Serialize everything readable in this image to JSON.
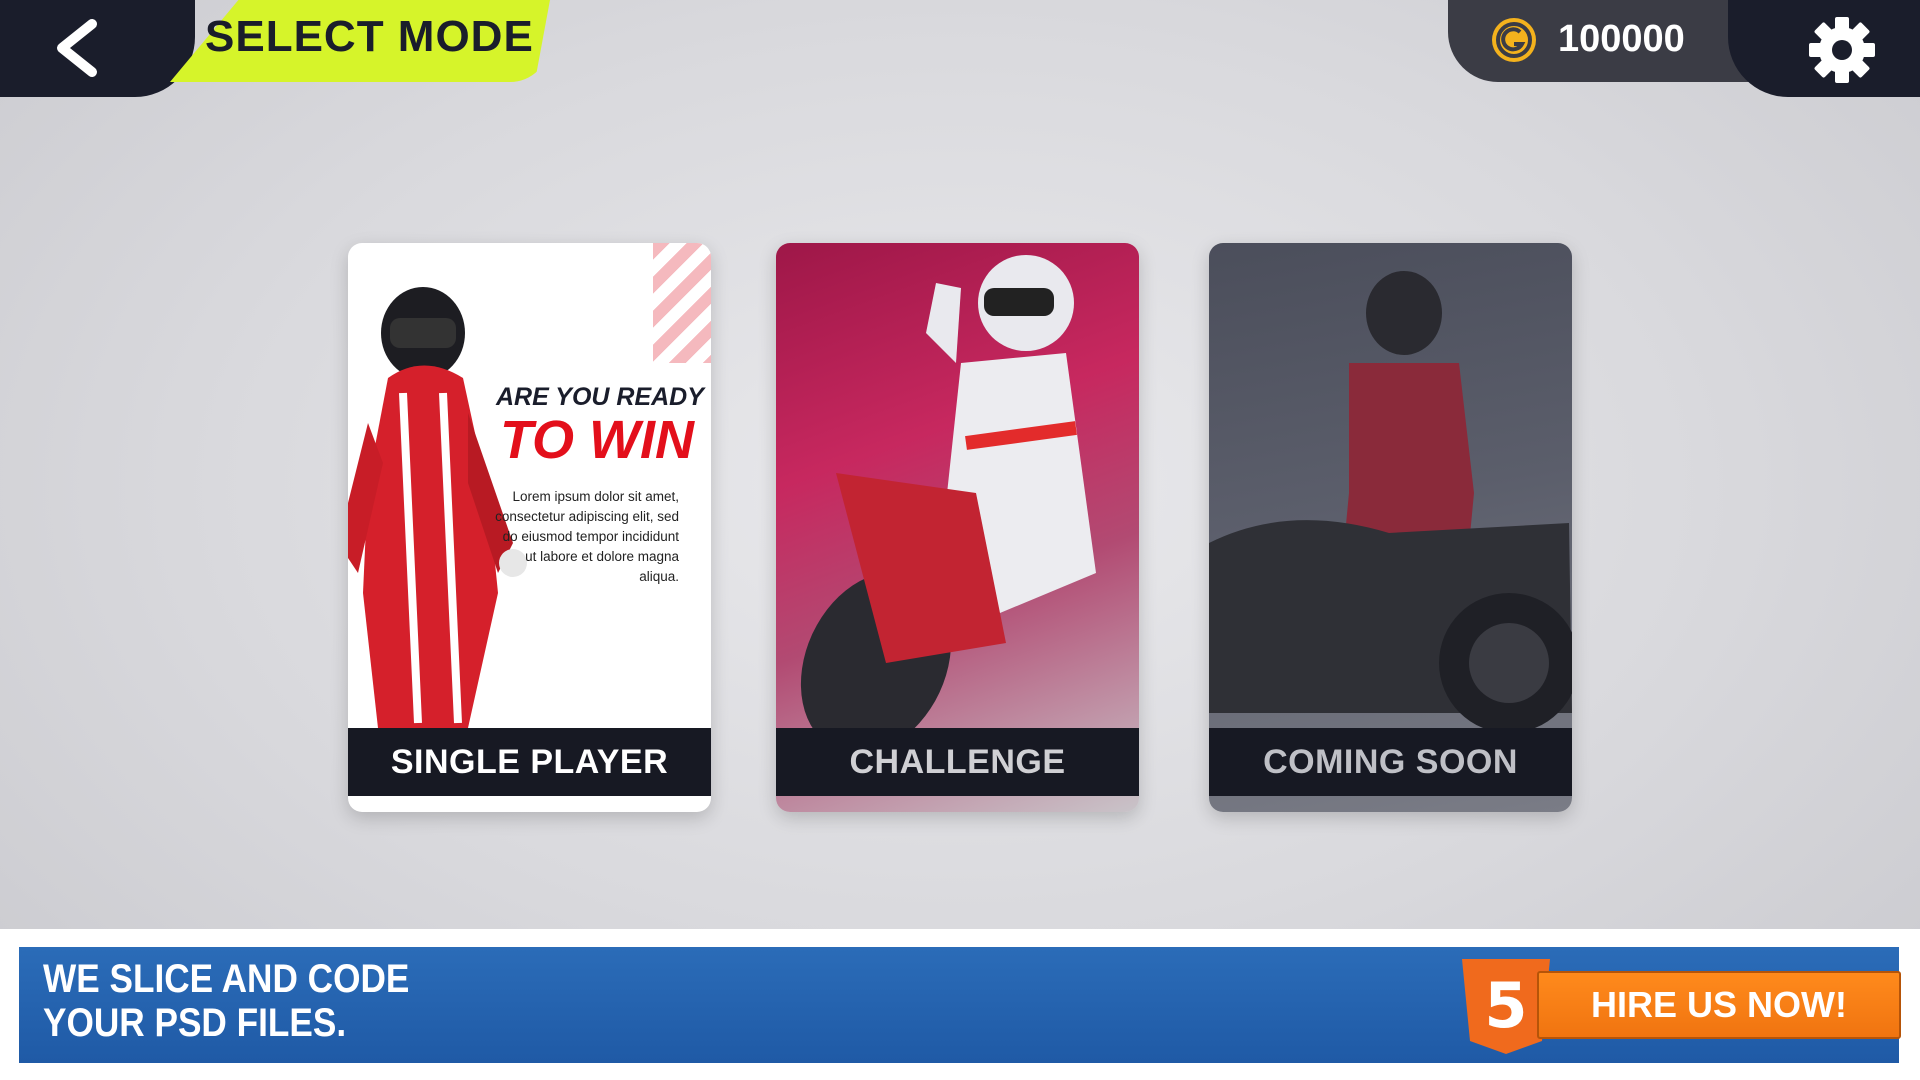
{
  "header": {
    "title": "SELECT MODE",
    "coins": "100000",
    "accent_color": "#d6f42a",
    "dark_color": "#1a1d2b"
  },
  "modes": [
    {
      "label": "SINGLE PLAYER",
      "headline_small": "ARE YOU READY",
      "headline_big": "TO WIN",
      "description": "Lorem ipsum dolor sit amet, consectetur adipiscing elit, sed do eiusmod tempor incididunt ut labore et dolore magna aliqua."
    },
    {
      "label": "CHALLENGE"
    },
    {
      "label": "COMING SOON"
    }
  ],
  "ad": {
    "line1": "WE SLICE AND CODE",
    "line2": "YOUR PSD FILES.",
    "badge": "5",
    "button": "HIRE US NOW!"
  },
  "icons": {
    "back": "chevron-left-icon",
    "coin": "coin-icon",
    "settings": "gear-icon"
  }
}
